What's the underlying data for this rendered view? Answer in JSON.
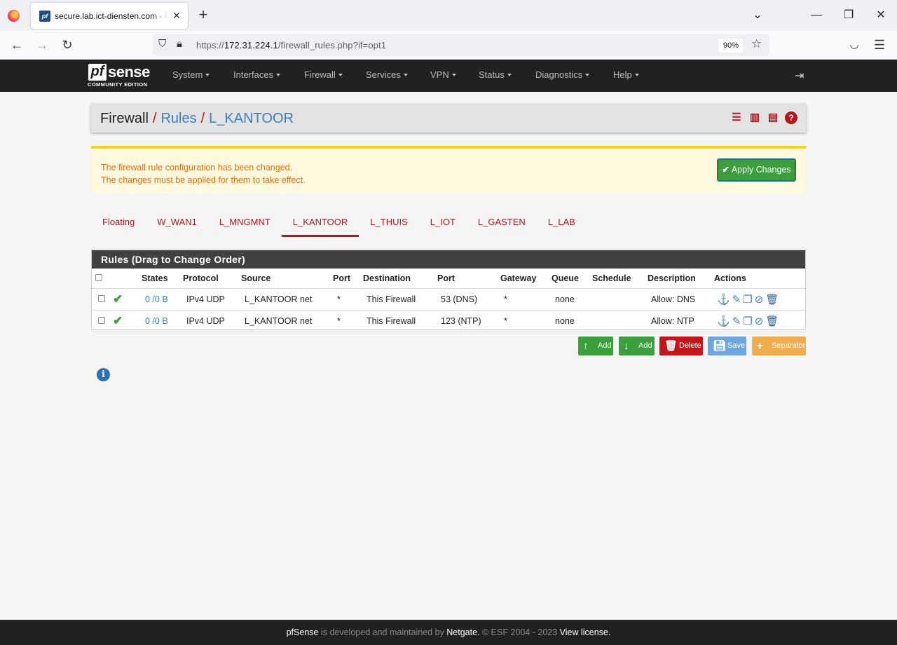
{
  "browser": {
    "tab_title": "secure.lab.ict-diensten.com - Firewall: Rules: L_KANTOOR",
    "tab_favicon": "pf",
    "url_prefix": "https://",
    "url_host": "172.31.224.1",
    "url_path": "/firewall_rules.php?if=opt1",
    "zoom": "90%"
  },
  "pfsense": {
    "logo_main": "sense",
    "logo_pf": "pf",
    "logo_sub": "COMMUNITY EDITION",
    "menu": [
      "System",
      "Interfaces",
      "Firewall",
      "Services",
      "VPN",
      "Status",
      "Diagnostics",
      "Help"
    ]
  },
  "breadcrumb": {
    "root": "Firewall",
    "sep": "/",
    "section": "Rules",
    "current": "L_KANTOOR"
  },
  "alert": {
    "line1": "The firewall rule configuration has been changed.",
    "line2": "The changes must be applied for them to take effect.",
    "apply_label": "Apply Changes"
  },
  "tabs": [
    "Floating",
    "W_WAN1",
    "L_MNGMNT",
    "L_KANTOOR",
    "L_THUIS",
    "L_IOT",
    "L_GASTEN",
    "L_LAB"
  ],
  "active_tab": "L_KANTOOR",
  "rules": {
    "title": "Rules (Drag to Change Order)",
    "columns": [
      "States",
      "Protocol",
      "Source",
      "Port",
      "Destination",
      "Port",
      "Gateway",
      "Queue",
      "Schedule",
      "Description",
      "Actions"
    ],
    "rows": [
      {
        "states": "0 /0 B",
        "protocol": "IPv4 UDP",
        "source": "L_KANTOOR net",
        "sport": "*",
        "destination": "This Firewall",
        "dport": "53 (DNS)",
        "gateway": "*",
        "queue": "none",
        "schedule": "",
        "description": "Allow: DNS"
      },
      {
        "states": "0 /0 B",
        "protocol": "IPv4 UDP",
        "source": "L_KANTOOR net",
        "sport": "*",
        "destination": "This Firewall",
        "dport": "123 (NTP)",
        "gateway": "*",
        "queue": "none",
        "schedule": "",
        "description": "Allow: NTP"
      }
    ]
  },
  "buttons": {
    "add_top": "Add",
    "add_bottom": "Add",
    "delete": "Delete",
    "save": "Save",
    "separator": "Separator"
  },
  "footer": {
    "brand": "pfSense",
    "text1": " is developed and maintained by ",
    "company": "Netgate.",
    "text2": " © ESF 2004 - 2023 ",
    "license": "View license."
  },
  "colors": {
    "brand_red": "#b3161b",
    "link_blue": "#3c7fba",
    "success_green": "#3c9e3c",
    "warning_bg": "#fffadf"
  }
}
